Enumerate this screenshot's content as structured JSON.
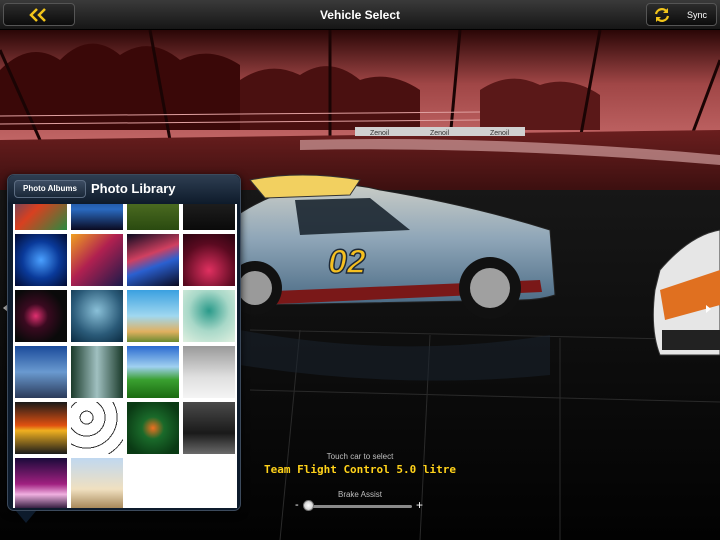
{
  "header": {
    "title": "Vehicle Select",
    "back_icon": "double-chevron-left-icon",
    "sync_label": "Sync",
    "sync_icon": "sync-arrows-icon"
  },
  "scene": {
    "barrier_text": [
      "Zenoil",
      "Zenoil",
      "Zenoil"
    ],
    "car_number": "02"
  },
  "photo_picker": {
    "albums_button": "Photo Albums",
    "title": "Photo Library",
    "thumbnail_count": 22
  },
  "vehicle": {
    "hint": "Touch car to select",
    "name": "Team Flight Control 5.0 litre"
  },
  "brake_assist": {
    "label": "Brake Assist",
    "minus": "-",
    "plus": "+",
    "value": 0
  },
  "colors": {
    "accent_yellow": "#ffd21a",
    "popover_bg": "#0d1b2c"
  }
}
